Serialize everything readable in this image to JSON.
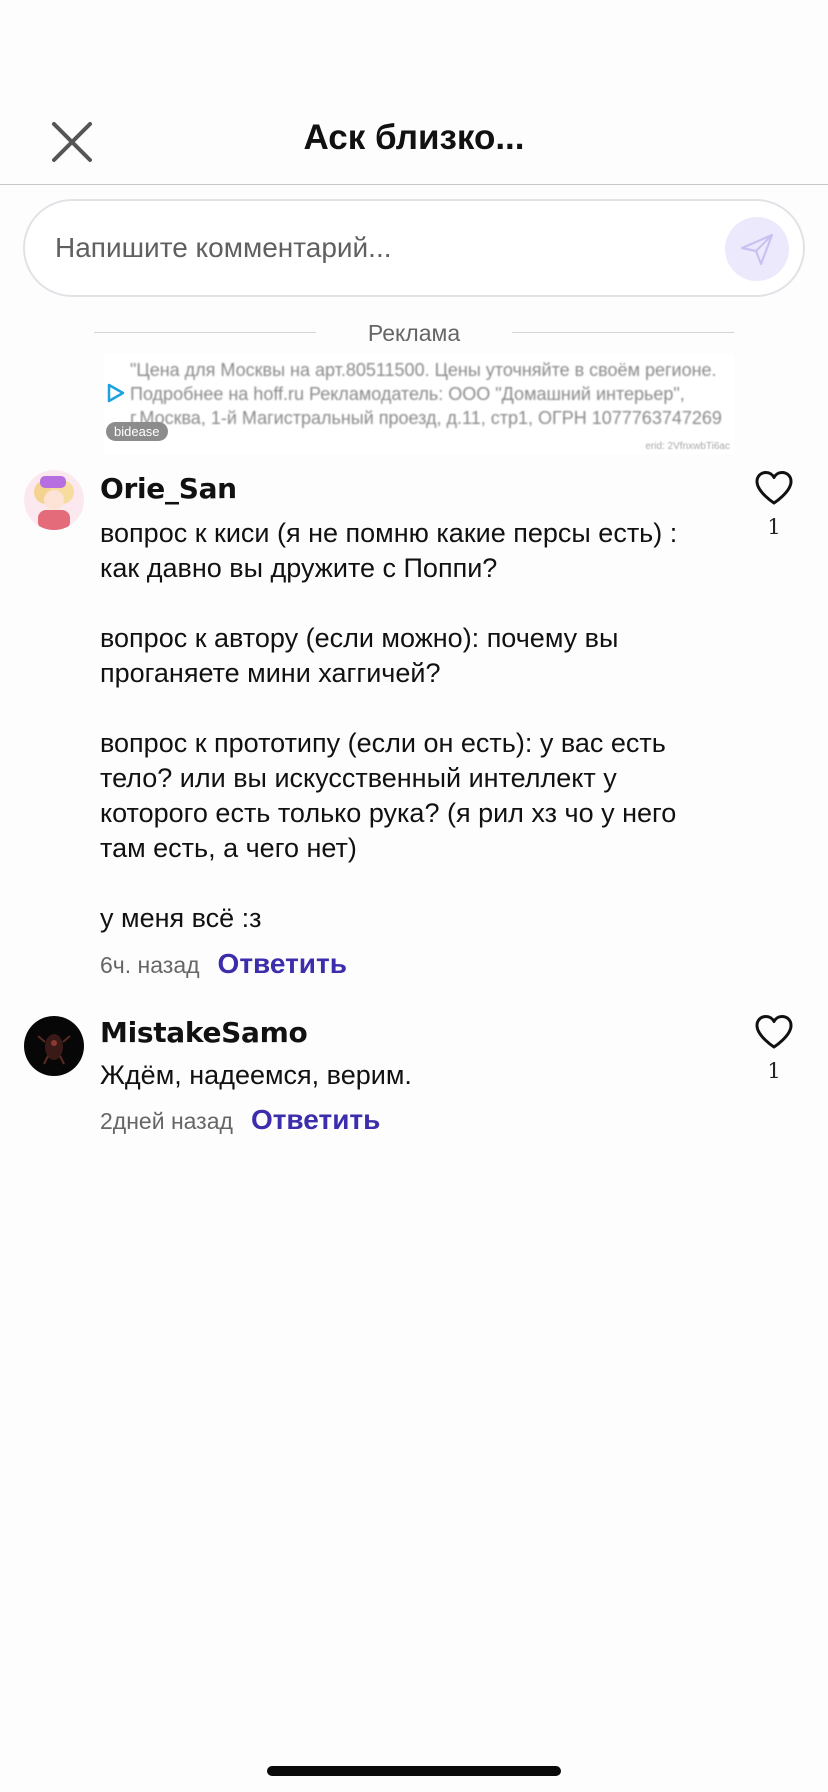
{
  "header": {
    "title": "Аск близко..."
  },
  "composer": {
    "placeholder": "Напишите комментарий..."
  },
  "ad": {
    "label": "Реклама",
    "text": "\"Цена для Москвы на арт.80511500. Цены уточняйте в своём регионе. Подробнее на hoff.ru Рекламодатель: ООО \"Домашний интерьер\", г.Москва, 1-й Магистральный проезд, д.11, стр1, ОГРН 1077763747269",
    "badge": "bidease",
    "erid": "erid: 2VfnxwbTi6ac"
  },
  "comments": [
    {
      "username": "Orie_San",
      "paragraphs": [
        "вопрос к киси (я не помню какие персы есть) : как давно вы дружите с Поппи?",
        "",
        "вопрос к автору (если можно): почему вы проганяете мини хаггичей?",
        "",
        "вопрос к прототипу (если он есть): у вас есть тело? или вы искусственный интеллект у которого есть только рука? (я рил хз чо у него там есть, а чего нет)",
        "",
        "у меня всё :з"
      ],
      "time": "6ч. назад",
      "reply_label": "Ответить",
      "likes": "1"
    },
    {
      "username": "MistakeSamo",
      "paragraphs": [
        "Ждём, надеемся, верим."
      ],
      "time": "2дней назад",
      "reply_label": "Ответить",
      "likes": "1"
    }
  ],
  "colors": {
    "accent": "#3b2dab",
    "send_bg": "#ece9fc"
  }
}
